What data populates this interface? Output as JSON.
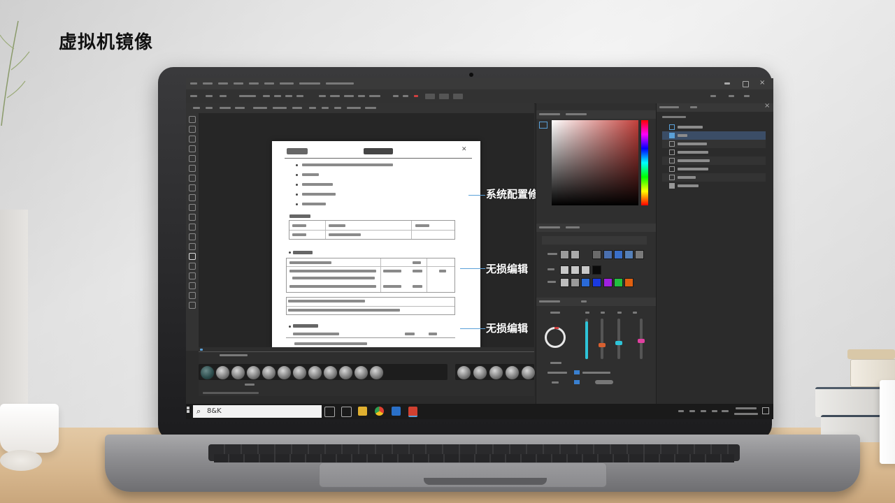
{
  "slide": {
    "title": "虚拟机镜像"
  },
  "callouts": [
    {
      "label": "系统配置修改"
    },
    {
      "label": "无损编辑"
    },
    {
      "label": "无损编辑"
    }
  ],
  "taskbar": {
    "search_text": "8&K"
  },
  "colors": {
    "accent": "#5aa0d8",
    "picker_red": "#c2403b",
    "slider_cyan": "#2ec4d8",
    "slider_magenta": "#e040a0"
  },
  "swatch_rows": [
    [
      "#9a9a9a",
      "#a9a9a9",
      "#6a6a6a",
      "#4a6fae",
      "#3a6fc8",
      "#5580b8",
      "#7a7a7a"
    ],
    [
      "#c8c8c8",
      "#c8c8c8",
      "#c8c8c8",
      "#0a0a0a"
    ],
    [
      "#bdbdbd",
      "#9a9a9a",
      "#2a6ad8",
      "#1a3ae0",
      "#a020e0",
      "#22c040",
      "#e06010"
    ]
  ]
}
